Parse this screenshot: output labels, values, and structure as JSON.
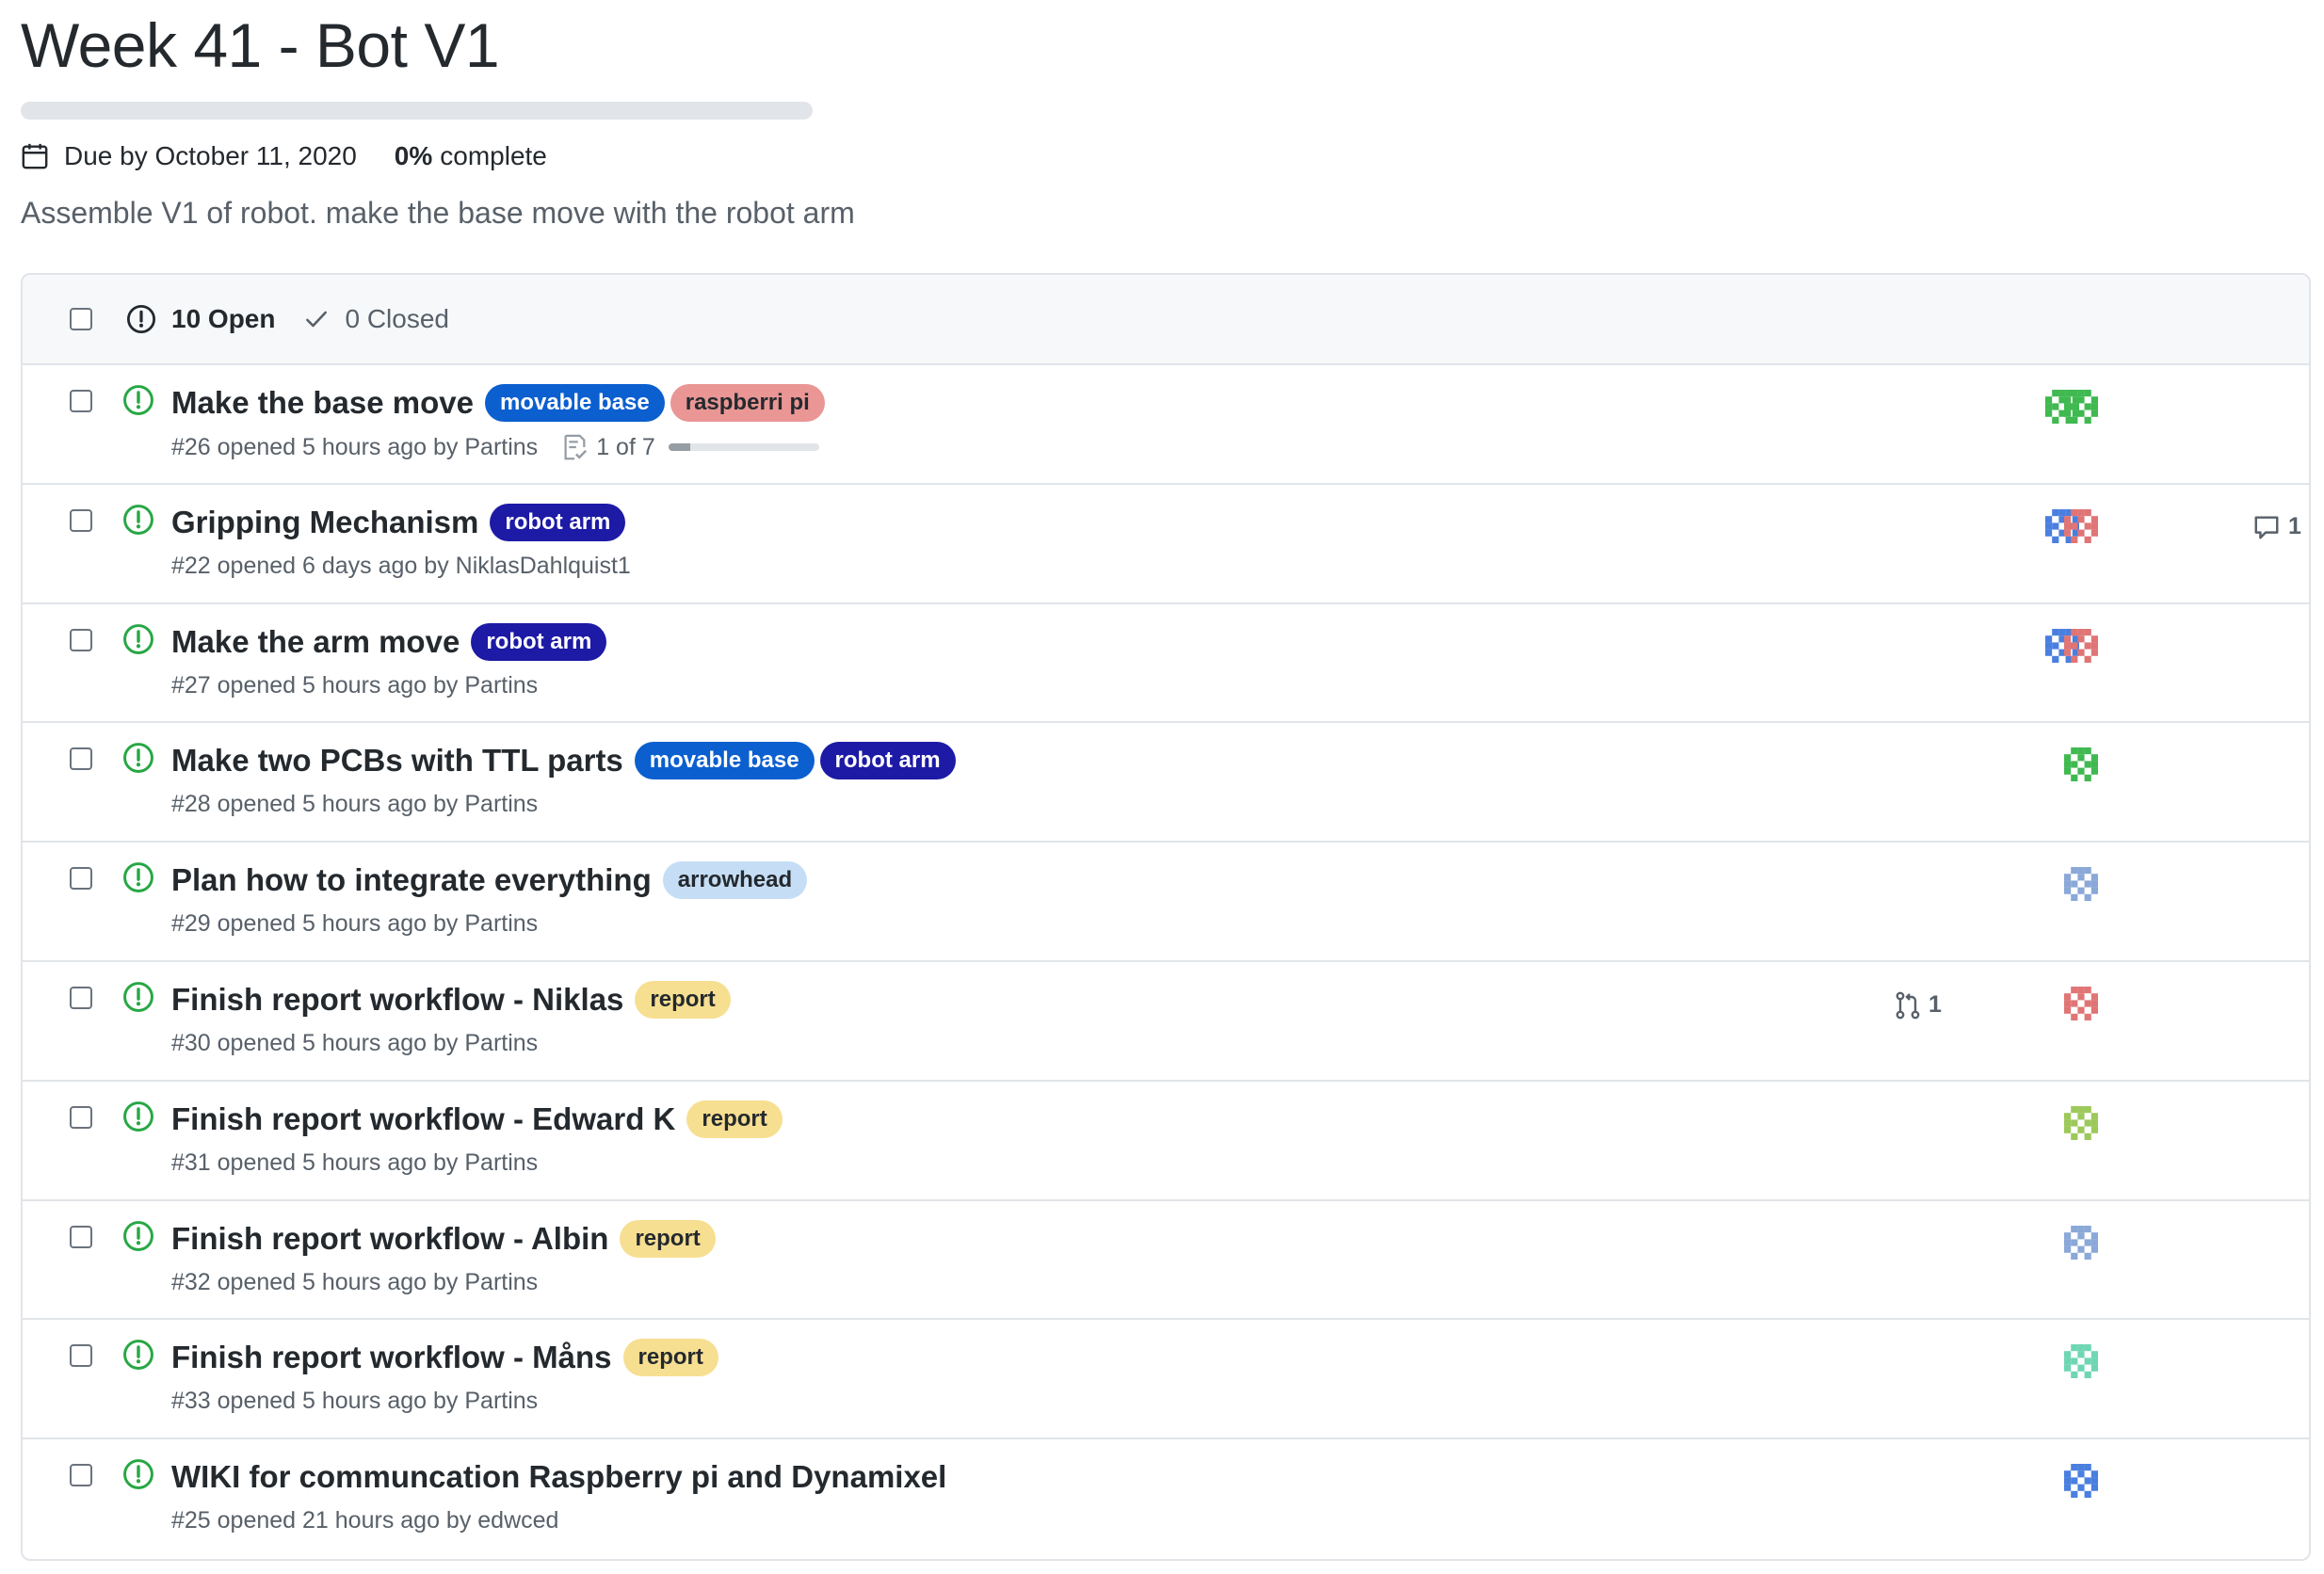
{
  "milestone": {
    "title": "Week 41 - Bot V1",
    "due_text": "Due by October 11, 2020",
    "progress_percent": 0,
    "complete_percent": "0%",
    "complete_word": "complete",
    "description": "Assemble V1 of robot. make the base move with the robot arm"
  },
  "list_header": {
    "open_label": "10 Open",
    "closed_label": "0 Closed"
  },
  "colors": {
    "open_issue": "#28a745",
    "label_movable_base": "#0b5fcf",
    "label_raspberri_pi": "#e99695",
    "label_robot_arm": "#1d1aa5",
    "label_arrowhead": "#c5def5",
    "label_report": "#f7df91"
  },
  "issues": [
    {
      "title": "Make the base move",
      "meta": "#26 opened 5 hours ago by Partins",
      "labels": [
        {
          "name": "movable base",
          "bg": "#0b5fcf",
          "fg": "#ffffff"
        },
        {
          "name": "raspberri pi",
          "bg": "#e99695",
          "fg": "#24292e"
        }
      ],
      "tasks": {
        "text": "1 of 7",
        "done": 1,
        "total": 7
      },
      "assignee_icons": [
        "identicon-green",
        "identicon-green"
      ]
    },
    {
      "title": "Gripping Mechanism",
      "meta": "#22 opened 6 days ago by NiklasDahlquist1",
      "labels": [
        {
          "name": "robot arm",
          "bg": "#1d1aa5",
          "fg": "#ffffff"
        }
      ],
      "comments": "1",
      "assignee_icons": [
        "identicon-blue",
        "identicon-red"
      ]
    },
    {
      "title": "Make the arm move",
      "meta": "#27 opened 5 hours ago by Partins",
      "labels": [
        {
          "name": "robot arm",
          "bg": "#1d1aa5",
          "fg": "#ffffff"
        }
      ],
      "assignee_icons": [
        "identicon-blue",
        "identicon-red"
      ]
    },
    {
      "title": "Make two PCBs with TTL parts",
      "meta": "#28 opened 5 hours ago by Partins",
      "labels": [
        {
          "name": "movable base",
          "bg": "#0b5fcf",
          "fg": "#ffffff"
        },
        {
          "name": "robot arm",
          "bg": "#1d1aa5",
          "fg": "#ffffff"
        }
      ],
      "assignee_icons": [
        "identicon-green"
      ]
    },
    {
      "title": "Plan how to integrate everything",
      "meta": "#29 opened 5 hours ago by Partins",
      "labels": [
        {
          "name": "arrowhead",
          "bg": "#c5def5",
          "fg": "#24292e"
        }
      ],
      "assignee_icons": [
        "identicon-lightblue"
      ]
    },
    {
      "title": "Finish report workflow - Niklas",
      "meta": "#30 opened 5 hours ago by Partins",
      "labels": [
        {
          "name": "report",
          "bg": "#f7df91",
          "fg": "#24292e"
        }
      ],
      "linked_prs": "1",
      "assignee_icons": [
        "identicon-red"
      ]
    },
    {
      "title": "Finish report workflow - Edward K",
      "meta": "#31 opened 5 hours ago by Partins",
      "labels": [
        {
          "name": "report",
          "bg": "#f7df91",
          "fg": "#24292e"
        }
      ],
      "assignee_icons": [
        "identicon-lime"
      ]
    },
    {
      "title": "Finish report workflow - Albin",
      "meta": "#32 opened 5 hours ago by Partins",
      "labels": [
        {
          "name": "report",
          "bg": "#f7df91",
          "fg": "#24292e"
        }
      ],
      "assignee_icons": [
        "identicon-lightblue"
      ]
    },
    {
      "title": "Finish report workflow - Måns",
      "meta": "#33 opened 5 hours ago by Partins",
      "labels": [
        {
          "name": "report",
          "bg": "#f7df91",
          "fg": "#24292e"
        }
      ],
      "assignee_icons": [
        "identicon-teal"
      ]
    },
    {
      "title": "WIKI for communcation Raspberry pi and Dynamixel",
      "meta": "#25 opened 21 hours ago by edwced",
      "labels": [],
      "assignee_icons": [
        "identicon-blue"
      ]
    }
  ]
}
